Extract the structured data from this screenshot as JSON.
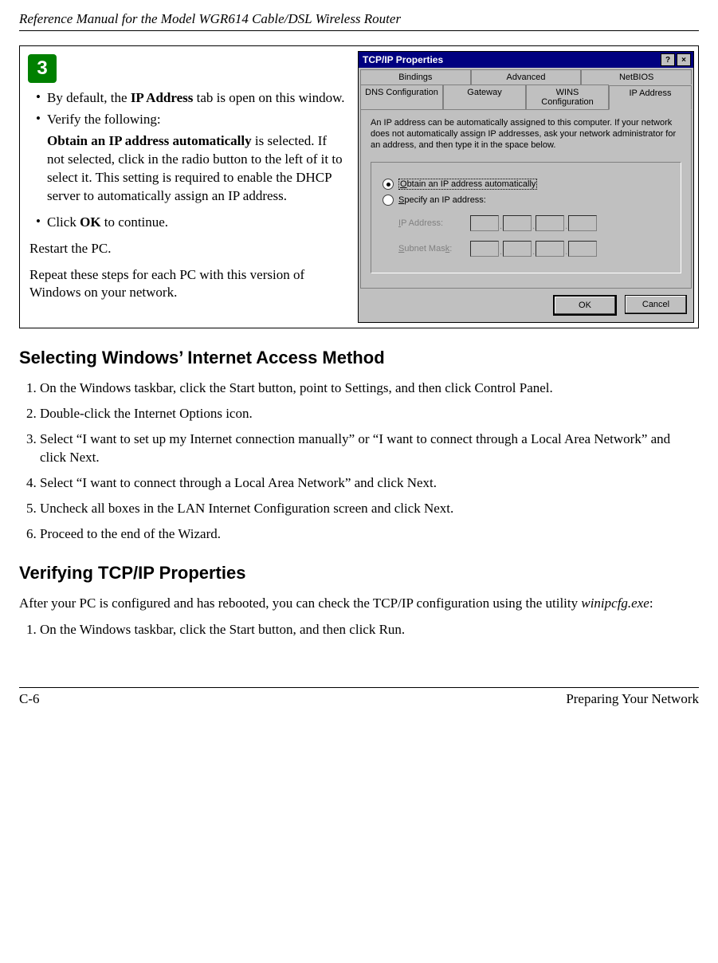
{
  "header": {
    "title": "Reference Manual for the Model WGR614 Cable/DSL Wireless Router"
  },
  "step": {
    "number": "3",
    "bullets": {
      "b1a": "By default, the ",
      "b1b_bold": "IP Address",
      "b1c": " tab is open on this window.",
      "b2": "Verify the following:",
      "b2sub_a_bold": "Obtain an IP address automatically",
      "b2sub_b": " is selected. If not selected, click in the radio button to the left of it to select it.  This setting is required to enable the DHCP server to automatically assign an IP address.",
      "b3a": "Click ",
      "b3b_bold": "OK",
      "b3c": " to continue."
    },
    "plain1": "Restart the PC.",
    "plain2": "Repeat these steps for each PC with this version of Windows on your network."
  },
  "dialog": {
    "title": "TCP/IP Properties",
    "help_glyph": "?",
    "close_glyph": "×",
    "tabs_row1": {
      "t1": "Bindings",
      "t2": "Advanced",
      "t3": "NetBIOS"
    },
    "tabs_row2": {
      "t1": "DNS Configuration",
      "t2": "Gateway",
      "t3": "WINS Configuration",
      "t4": "IP Address"
    },
    "desc": "An IP address can be automatically assigned to this computer. If your network does not automatically assign IP addresses, ask your network administrator for an address, and then type it in the space below.",
    "radio1_u": "O",
    "radio1_rest": "btain an IP address automatically",
    "radio2_u": "S",
    "radio2_rest": "pecify an IP address:",
    "field1_u": "I",
    "field1_rest": "P Address:",
    "field2_u1": "S",
    "field2_mid": "ubnet Mas",
    "field2_u2": "k",
    "field2_end": ":",
    "ok": "OK",
    "cancel": "Cancel",
    "dot": "."
  },
  "sections": {
    "h1": "Selecting Windows’ Internet Access Method",
    "s1_li1": "On the Windows taskbar, click the Start button, point to Settings, and then click Control Panel.",
    "s1_li2": "Double-click the Internet Options icon.",
    "s1_li3": "Select “I want to set up my Internet connection manually” or “I want to connect through a Local Area Network” and click Next.",
    "s1_li4": "Select “I want to connect through a Local Area Network” and click Next.",
    "s1_li5": "Uncheck all boxes in the LAN Internet Configuration screen and click Next.",
    "s1_li6": "Proceed to the end of the Wizard.",
    "h2": "Verifying TCP/IP Properties",
    "p1a": "After your PC is configured and has rebooted, you can check the TCP/IP configuration using the utility ",
    "p1b_italic": "winipcfg.exe",
    "p1c": ":",
    "s2_li1": "On the Windows taskbar, click the Start button, and then click Run."
  },
  "footer": {
    "left": "C-6",
    "right": "Preparing Your Network"
  }
}
